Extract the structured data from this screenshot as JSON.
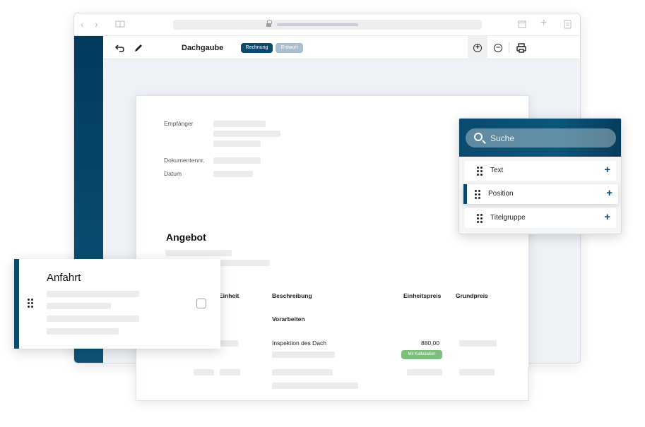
{
  "toolbar": {
    "document_title": "Dachgaube",
    "badges": [
      {
        "label": "Rechnung",
        "color": "#0b4a6f"
      },
      {
        "label": "Entwurf",
        "color": "#a9bfcf"
      }
    ],
    "icons": [
      "undo-icon",
      "pencil-icon",
      "zoom-in-icon",
      "zoom-out-icon",
      "print-icon"
    ]
  },
  "document": {
    "labels": {
      "recipient": "Empfänger",
      "document_number": "Dokumentennr.",
      "date": "Datum"
    },
    "heading": "Angebot",
    "table": {
      "headers": [
        "Einheit",
        "Beschreibung",
        "Einheitspreis",
        "Grundpreis"
      ],
      "group_title": "Vorarbeiten",
      "row": {
        "description": "Inspektion des Dach",
        "unit_price": "880,00",
        "badge": "Mit Kalkulation"
      }
    }
  },
  "floating_card": {
    "title": "Anfahrt"
  },
  "insert_panel": {
    "search_placeholder": "Suche",
    "items": [
      {
        "label": "Text",
        "active": false
      },
      {
        "label": "Position",
        "active": true
      },
      {
        "label": "Titelgruppe",
        "active": false
      }
    ]
  },
  "colors": {
    "brand": "#0b4a6f",
    "success": "#7cbf7c"
  }
}
